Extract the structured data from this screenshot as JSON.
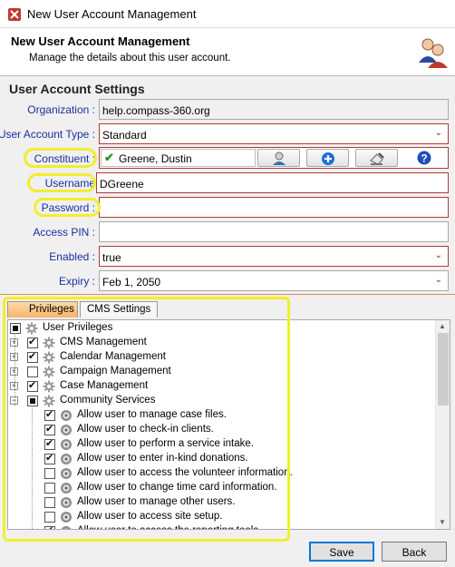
{
  "window": {
    "title": "New User Account Management"
  },
  "header": {
    "title": "New User Account Management",
    "subtitle": "Manage the details about this user account."
  },
  "settings": {
    "section_title": "User Account Settings",
    "organization": {
      "label": "Organization :",
      "value": "help.compass-360.org"
    },
    "account_type": {
      "label": "User Account Type :",
      "value": "Standard"
    },
    "constituent": {
      "label": "Constituent :",
      "value": "Greene, Dustin"
    },
    "username": {
      "label": "Username",
      "value": "DGreene"
    },
    "password": {
      "label": "Password :",
      "value": ""
    },
    "access_pin": {
      "label": "Access PIN :",
      "value": ""
    },
    "enabled": {
      "label": "Enabled :",
      "value": "true"
    },
    "expiry": {
      "label": "Expiry :",
      "value": "Feb 1, 2050"
    }
  },
  "tabs": [
    {
      "label": "Privileges",
      "active": true
    },
    {
      "label": "CMS Settings",
      "active": false
    }
  ],
  "tree": {
    "root": {
      "label": "User Privileges",
      "state": "partial",
      "expander": ""
    },
    "modules": [
      {
        "label": "CMS Management",
        "state": "checked",
        "expander": "+"
      },
      {
        "label": "Calendar Management",
        "state": "checked",
        "expander": "+"
      },
      {
        "label": "Campaign Management",
        "state": "unchecked",
        "expander": "+"
      },
      {
        "label": "Case Management",
        "state": "checked",
        "expander": "+"
      },
      {
        "label": "Community Services",
        "state": "partial",
        "expander": "-"
      }
    ],
    "permissions": [
      {
        "label": "Allow user to manage case files.",
        "state": "checked"
      },
      {
        "label": "Allow user to check-in clients.",
        "state": "checked"
      },
      {
        "label": "Allow user to perform a service intake.",
        "state": "checked"
      },
      {
        "label": "Allow user to enter in-kind donations.",
        "state": "checked"
      },
      {
        "label": "Allow user to access the volunteer information.",
        "state": "unchecked"
      },
      {
        "label": "Allow user to change time card information.",
        "state": "unchecked"
      },
      {
        "label": "Allow user to manage other users.",
        "state": "unchecked"
      },
      {
        "label": "Allow user to access site setup.",
        "state": "unchecked"
      },
      {
        "label": "Allow user to access the reporting tools.",
        "state": "checked"
      }
    ]
  },
  "buttons": {
    "save": "Save",
    "back": "Back"
  },
  "colors": {
    "highlight": "#f3ee2b",
    "label_blue": "#1a2fa0",
    "error_border": "#b03a3a",
    "tab_active": "#f7b56b"
  }
}
